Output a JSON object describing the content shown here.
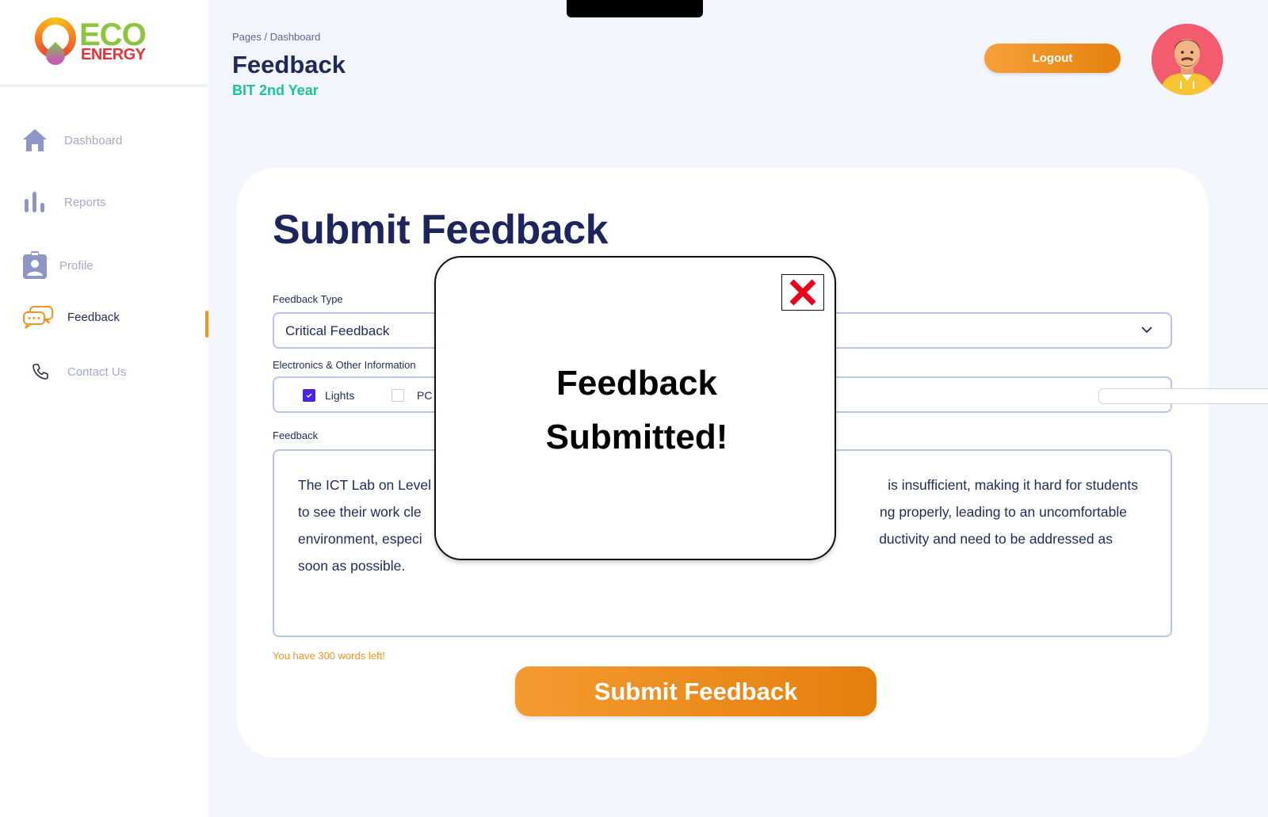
{
  "logo": {
    "line1": "ECO",
    "line2": "ENERGY"
  },
  "sidebar": {
    "items": [
      {
        "label": "Dashboard",
        "icon": "home-icon"
      },
      {
        "label": "Reports",
        "icon": "bar-chart-icon"
      },
      {
        "label": "Profile",
        "icon": "profile-badge-icon"
      },
      {
        "label": "Feedback",
        "icon": "chat-bubbles-icon",
        "active": true
      },
      {
        "label": "Contact Us",
        "icon": "phone-icon"
      }
    ]
  },
  "header": {
    "breadcrumb": "Pages / Dashboard",
    "title": "Feedback",
    "subtitle": "BIT 2nd Year",
    "logout_label": "Logout",
    "avatar_icon": "user-avatar-icon"
  },
  "form": {
    "title": "Submit Feedback",
    "feedback_type_label": "Feedback Type",
    "feedback_type_value": "Critical Feedback",
    "electronics_label": "Electronics & Other Information",
    "checkboxes": [
      {
        "label": "Lights",
        "checked": true
      },
      {
        "label": "PC",
        "checked": false
      }
    ],
    "feedback_label": "Feedback",
    "feedback_text_line1_left": "The ICT Lab on Level",
    "feedback_text_line1_right": "is insufficient, making it hard for students",
    "feedback_text_line2_left": "to see their work cle",
    "feedback_text_line2_right": "ng properly, leading to an uncomfortable",
    "feedback_text_line3_left": "environment, especi",
    "feedback_text_line3_right": "ductivity and need to be addressed as",
    "feedback_text_line4": "soon as possible.",
    "words_left": "You have 300 words left!",
    "submit_label": "Submit Feedback"
  },
  "modal": {
    "message_line1": "Feedback",
    "message_line2": "Submitted!",
    "close_icon": "close-x-icon"
  },
  "colors": {
    "accent_orange": "#f39325",
    "navy": "#1e2a5a",
    "teal": "#18c59b",
    "checkbox_purple": "#4b23e6",
    "close_red": "#e8001c"
  }
}
